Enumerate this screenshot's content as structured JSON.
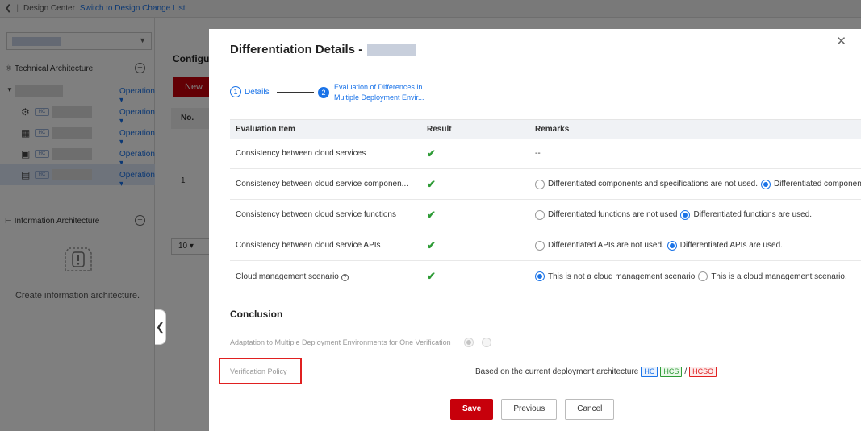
{
  "topbar": {
    "back_icon": "chevron-left-icon",
    "app_name": "Design Center",
    "switch_link": "Switch to Design Change List"
  },
  "sidebar": {
    "tech_section": "Technical Architecture",
    "info_section": "Information Architecture",
    "operation_label": "Operation",
    "tag_label": "HC",
    "rows": [
      {
        "icon": "expand-arrow-icon"
      },
      {
        "icon": "service-icon"
      },
      {
        "icon": "grid-icon"
      },
      {
        "icon": "apps-icon"
      },
      {
        "icon": "document-icon"
      }
    ],
    "empty_text": "Create information architecture."
  },
  "background_main": {
    "title_partial": "Configu",
    "new_button_partial": "New",
    "no_header": "No.",
    "row_number": "1",
    "page_size": "10"
  },
  "modal": {
    "title": "Differentiation Details -",
    "steps": [
      {
        "number": "1",
        "label": "Details"
      },
      {
        "number": "2",
        "label": "Evaluation of Differences in Multiple Deployment Envir..."
      }
    ],
    "table": {
      "headers": [
        "Evaluation Item",
        "Result",
        "Remarks"
      ],
      "rows": [
        {
          "item": "Consistency between cloud services",
          "remarks": "--",
          "options": []
        },
        {
          "item": "Consistency between cloud service componen...",
          "remarks": "",
          "options": [
            {
              "label": "Differentiated components and specifications are not used.",
              "checked": false
            },
            {
              "label": "Differentiated components and specifications are used.",
              "checked": true
            }
          ]
        },
        {
          "item": "Consistency between cloud service functions",
          "remarks": "",
          "options": [
            {
              "label": "Differentiated functions are not used",
              "checked": false
            },
            {
              "label": "Differentiated functions are used.",
              "checked": true
            }
          ]
        },
        {
          "item": "Consistency between cloud service APIs",
          "remarks": "",
          "options": [
            {
              "label": "Differentiated APIs are not used.",
              "checked": false
            },
            {
              "label": "Differentiated APIs are used.",
              "checked": true
            }
          ]
        },
        {
          "item": "Cloud management scenario",
          "remarks": "",
          "options": [
            {
              "label": "This is not a cloud management scenario",
              "checked": true
            },
            {
              "label": "This is a cloud management scenario.",
              "checked": false
            }
          ]
        }
      ]
    },
    "conclusion": {
      "title": "Conclusion",
      "adaptation_label": "Adaptation to Multiple Deployment Environments for One Verification",
      "policy_label": "Verification Policy",
      "policy_value": "Based on the current deployment architecture",
      "tags": [
        "HC",
        "HCS",
        "HCSO"
      ],
      "tag_separator": "/"
    },
    "buttons": {
      "save": "Save",
      "previous": "Previous",
      "cancel": "Cancel"
    }
  },
  "colors": {
    "primary_red": "#c7000b",
    "link_blue": "#1a73e8",
    "success_green": "#2e9b36",
    "highlight_red": "#e02020"
  }
}
